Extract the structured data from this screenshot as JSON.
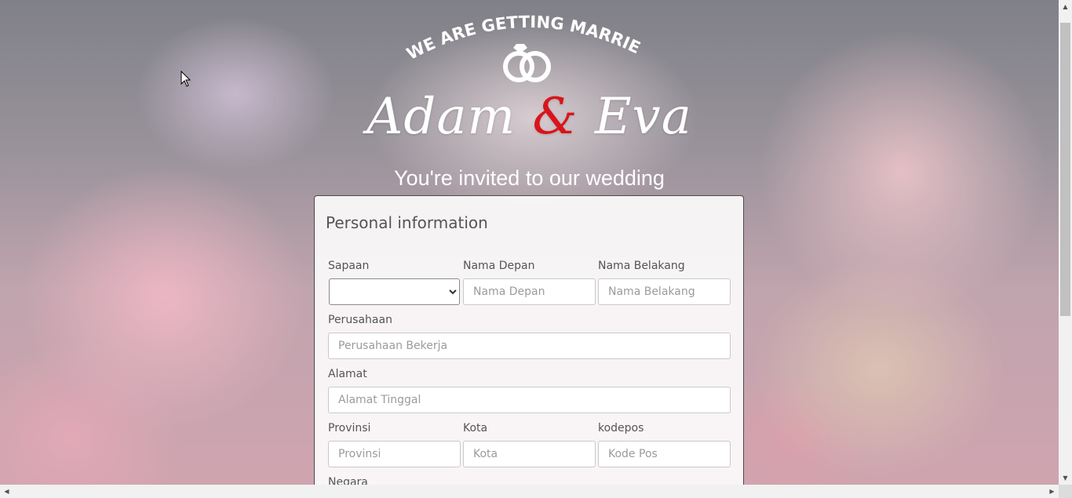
{
  "hero": {
    "tagline": "WE ARE GETTING MARRIED",
    "name_1": "Adam",
    "ampersand": "&",
    "name_2": "Eva",
    "invite": "You're invited to our wedding",
    "icon": "wedding-rings-icon",
    "accent_color": "#d9141b"
  },
  "form": {
    "title": "Personal information",
    "salutation": {
      "label": "Sapaan",
      "value": ""
    },
    "first_name": {
      "label": "Nama Depan",
      "placeholder": "Nama Depan"
    },
    "last_name": {
      "label": "Nama Belakang",
      "placeholder": "Nama Belakang"
    },
    "company": {
      "label": "Perusahaan",
      "placeholder": "Perusahaan Bekerja"
    },
    "address": {
      "label": "Alamat",
      "placeholder": "Alamat Tinggal"
    },
    "province": {
      "label": "Provinsi",
      "placeholder": "Provinsi"
    },
    "city": {
      "label": "Kota",
      "placeholder": "Kota"
    },
    "postal": {
      "label": "kodepos",
      "placeholder": "Kode Pos"
    },
    "country": {
      "label": "Negara"
    }
  }
}
